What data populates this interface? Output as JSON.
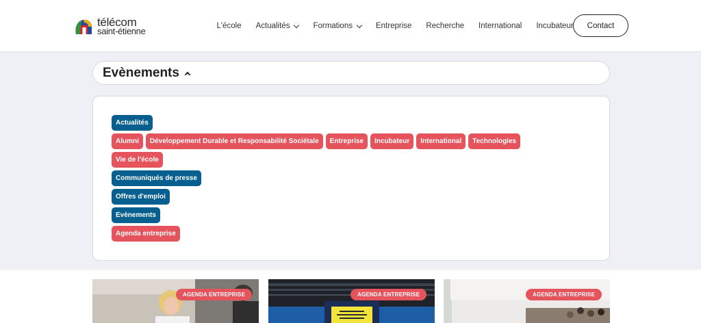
{
  "header": {
    "logo": {
      "line1": "télécom",
      "line2": "saint-étienne"
    },
    "nav": [
      {
        "label": "L'école",
        "dropdown": false
      },
      {
        "label": "Actualités",
        "dropdown": true
      },
      {
        "label": "Formations",
        "dropdown": true
      },
      {
        "label": "Entreprise",
        "dropdown": false
      },
      {
        "label": "Recherche",
        "dropdown": false
      },
      {
        "label": "International",
        "dropdown": false
      },
      {
        "label": "Incubateur",
        "dropdown": false
      }
    ],
    "contact_label": "Contact"
  },
  "section": {
    "title": "Evènements"
  },
  "filters": {
    "rows": [
      [
        {
          "label": "Actualités",
          "color": "blue"
        }
      ],
      [
        {
          "label": "Alumni",
          "color": "red"
        },
        {
          "label": "Développement Durable et Responsabilité Sociétale",
          "color": "red"
        },
        {
          "label": "Entreprise",
          "color": "red"
        },
        {
          "label": "Incubateur",
          "color": "red"
        },
        {
          "label": "International",
          "color": "red"
        },
        {
          "label": "Technologies",
          "color": "red"
        }
      ],
      [
        {
          "label": "Vie de l'école",
          "color": "red"
        }
      ],
      [
        {
          "label": "Communiqués de presse",
          "color": "blue"
        }
      ],
      [
        {
          "label": "Offres d'emploi",
          "color": "blue"
        }
      ],
      [
        {
          "label": "Evènements",
          "color": "blue"
        }
      ],
      [
        {
          "label": "Agenda entreprise",
          "color": "red"
        }
      ]
    ],
    "colors": {
      "blue": "#065f8e",
      "red": "#e5545d"
    }
  },
  "cards": [
    {
      "badge": "AGENDA ENTREPRISE",
      "image": "person-at-table-photo"
    },
    {
      "badge": "AGENDA ENTREPRISE",
      "image": "forum-stage-photo"
    },
    {
      "badge": "AGENDA ENTREPRISE",
      "image": "lecture-hall-photo"
    }
  ]
}
